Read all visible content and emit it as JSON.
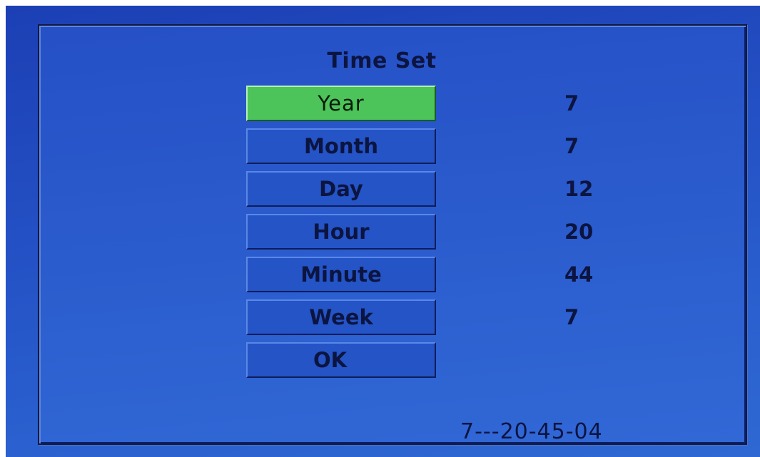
{
  "title": "Time Set",
  "menu": {
    "items": [
      {
        "label": "Year",
        "value": "7",
        "selected": true
      },
      {
        "label": "Month",
        "value": "7",
        "selected": false
      },
      {
        "label": "Day",
        "value": "12",
        "selected": false
      },
      {
        "label": "Hour",
        "value": "20",
        "selected": false
      },
      {
        "label": "Minute",
        "value": "44",
        "selected": false
      },
      {
        "label": "Week",
        "value": "7",
        "selected": false
      }
    ],
    "ok_label": "OK"
  },
  "status": {
    "clock": "7---20-45-04"
  },
  "colors": {
    "background": "#2454c6",
    "selected": "#4cc45a",
    "text": "#0c1440"
  }
}
